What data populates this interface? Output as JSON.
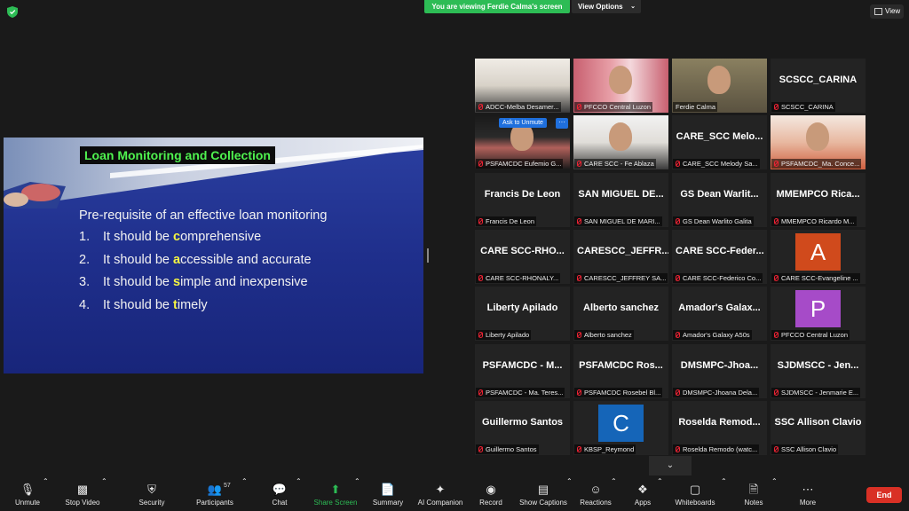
{
  "top": {
    "banner": "You are viewing Ferdie Calma's screen",
    "view_options": "View Options",
    "view_button": "View"
  },
  "slide": {
    "title": "Loan Monitoring and Collection",
    "heading": "Pre-requisite of an effective loan monitoring",
    "items": [
      {
        "num": "1.",
        "pre": "It should be ",
        "hl": "c",
        "post": "omprehensive"
      },
      {
        "num": "2.",
        "pre": "It should be ",
        "hl": "a",
        "post": "ccessible and accurate"
      },
      {
        "num": "3.",
        "pre": "It should be ",
        "hl": "s",
        "post": "imple and inexpensive"
      },
      {
        "num": "4.",
        "pre": "It should be ",
        "hl": "t",
        "post": "imely"
      }
    ]
  },
  "participants": {
    "ask_to_unmute": "Ask to Unmute",
    "more": "···",
    "tiles": [
      {
        "big": "",
        "label": "ADCC-Melba Desamer..."
      },
      {
        "big": "",
        "label": "PFCCO Central Luzon"
      },
      {
        "big": "",
        "label": "Ferdie Calma"
      },
      {
        "big": "SCSCC_CARINA",
        "label": "SCSCC_CARINA"
      },
      {
        "big": "",
        "label": "PSFAMCDC Eufemio G..."
      },
      {
        "big": "",
        "label": "CARE SCC - Fe Ablaza"
      },
      {
        "big": "CARE_SCC Melo...",
        "label": "CARE_SCC Melody Sa..."
      },
      {
        "big": "",
        "label": "PSFAMCDC_Ma. Conce..."
      },
      {
        "big": "Francis De Leon",
        "label": "Francis De Leon"
      },
      {
        "big": "SAN MIGUEL DE...",
        "label": "SAN MIGUEL DE MARI..."
      },
      {
        "big": "GS Dean Warlit...",
        "label": "GS Dean Warlito Galita"
      },
      {
        "big": "MMEMPCO Rica...",
        "label": "MMEMPCO Ricardo M..."
      },
      {
        "big": "CARE SCC-RHO...",
        "label": "CARE SCC-RHONALY..."
      },
      {
        "big": "CARESCC_JEFFR...",
        "label": "CARESCC_JEFFREY SA..."
      },
      {
        "big": "CARE SCC-Feder...",
        "label": "CARE SCC-Federico Co..."
      },
      {
        "big": "A",
        "label": "CARE SCC-Evangeline ..."
      },
      {
        "big": "Liberty Apilado",
        "label": "Liberty Apilado"
      },
      {
        "big": "Alberto sanchez",
        "label": "Alberto sanchez"
      },
      {
        "big": "Amador's Galax...",
        "label": "Amador's Galaxy A50s"
      },
      {
        "big": "P",
        "label": "PFCCO Central Luzon"
      },
      {
        "big": "PSFAMCDC - M...",
        "label": "PSFAMCDC - Ma. Teres..."
      },
      {
        "big": "PSFAMCDC Ros...",
        "label": "PSFAMCDC Rosebel Bl..."
      },
      {
        "big": "DMSMPC-Jhoa...",
        "label": "DMSMPC-Jhoana Dela..."
      },
      {
        "big": "SJDMSCC - Jen...",
        "label": "SJDMSCC - Jenmarie E..."
      },
      {
        "big": "Guillermo Santos",
        "label": "Guillermo Santos"
      },
      {
        "big": "C",
        "label": "KBSP_Reymond"
      },
      {
        "big": "Roselda Remod...",
        "label": "Roselda Remodo (watc..."
      },
      {
        "big": "SSC Allison Clavio",
        "label": "SSC Allison Clavio"
      }
    ]
  },
  "toolbar": {
    "unmute": "Unmute",
    "stop_video": "Stop Video",
    "security": "Security",
    "participants": "Participants",
    "participants_count": "57",
    "chat": "Chat",
    "share_screen": "Share Screen",
    "summary": "Summary",
    "ai_companion": "AI Companion",
    "record": "Record",
    "show_captions": "Show Captions",
    "reactions": "Reactions",
    "apps": "Apps",
    "whiteboards": "Whiteboards",
    "notes": "Notes",
    "more": "More",
    "end": "End"
  },
  "colors": {
    "avatar_a": "#d04a1c",
    "avatar_p": "#a64bc8",
    "avatar_c": "#1565b8",
    "share_green": "#2dbc55",
    "end_red": "#d93025"
  }
}
